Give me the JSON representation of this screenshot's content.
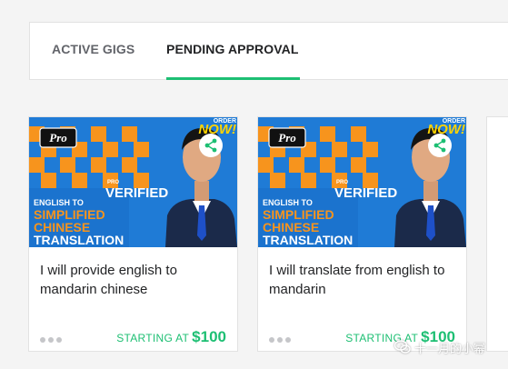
{
  "tabs": {
    "items": [
      {
        "label": "ACTIVE GIGS"
      },
      {
        "label": "PENDING APPROVAL"
      }
    ],
    "active_index": 1,
    "accent_color": "#1dbf73"
  },
  "gigs": [
    {
      "title": "I will provide english to mandarin chinese",
      "starting_label": "STARTING AT",
      "price": "$100",
      "thumbnail": {
        "badge": "Pro",
        "corner_text_1": "ORDER",
        "corner_text_2": "NOW!",
        "pro_small": "PRO",
        "verified": "VERIFIED",
        "line1": "ENGLISH TO",
        "line2": "SIMPLIFIED",
        "line3": "CHINESE",
        "line4": "TRANSLATION"
      }
    },
    {
      "title": "I will translate from english to mandarin",
      "starting_label": "STARTING AT",
      "price": "$100",
      "thumbnail": {
        "badge": "Pro",
        "corner_text_1": "ORDER",
        "corner_text_2": "NOW!",
        "pro_small": "PRO",
        "verified": "VERIFIED",
        "line1": "ENGLISH TO",
        "line2": "SIMPLIFIED",
        "line3": "CHINESE",
        "line4": "TRANSLATION"
      }
    }
  ],
  "icons": {
    "share": "share-icon",
    "more": "more-dots-icon"
  },
  "watermark": {
    "text": "十一月的小幂"
  },
  "colors": {
    "price": "#1dbf73",
    "thumb_blue": "#1f7bd6",
    "thumb_orange": "#f7941d",
    "thumb_yellow": "#ffd400"
  }
}
